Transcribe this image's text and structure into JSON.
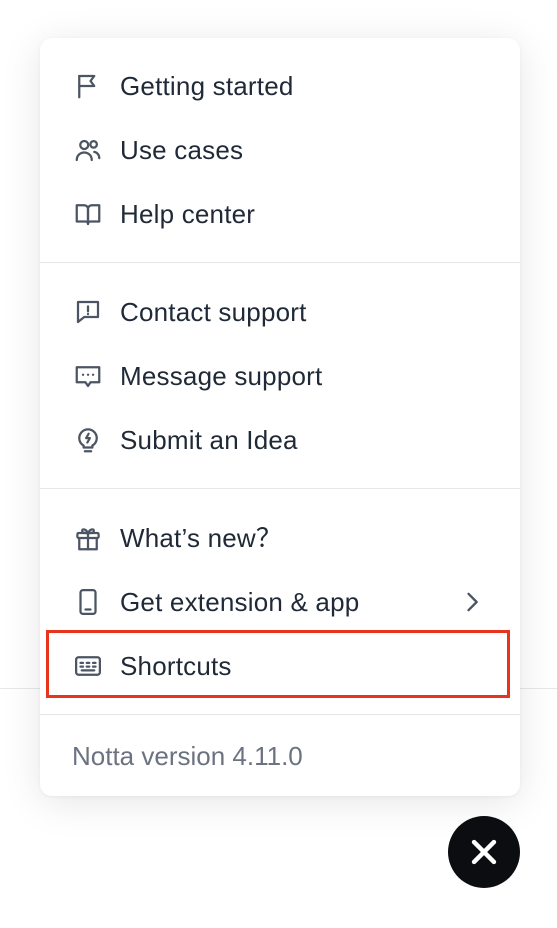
{
  "menu": {
    "groups": [
      {
        "items": [
          {
            "label": "Getting started",
            "icon": "flag-icon"
          },
          {
            "label": "Use cases",
            "icon": "users-icon"
          },
          {
            "label": "Help center",
            "icon": "book-icon"
          }
        ]
      },
      {
        "items": [
          {
            "label": "Contact support",
            "icon": "alert-message-icon"
          },
          {
            "label": "Message support",
            "icon": "chat-dots-icon"
          },
          {
            "label": "Submit an Idea",
            "icon": "lightbulb-icon"
          }
        ]
      },
      {
        "items": [
          {
            "label": "What’s new？",
            "icon": "gift-icon"
          },
          {
            "label": "Get extension & app",
            "icon": "phone-icon",
            "has_submenu": true
          },
          {
            "label": "Shortcuts",
            "icon": "keyboard-icon",
            "highlighted": true
          }
        ]
      }
    ],
    "version": "Notta version 4.11.0"
  },
  "close_button": {
    "icon": "close-icon"
  },
  "colors": {
    "highlight_border": "#e8341c",
    "close_button_bg": "#0b0d10",
    "text": "#1f2937",
    "muted_text": "#6b7280",
    "icon": "#4b5563"
  }
}
